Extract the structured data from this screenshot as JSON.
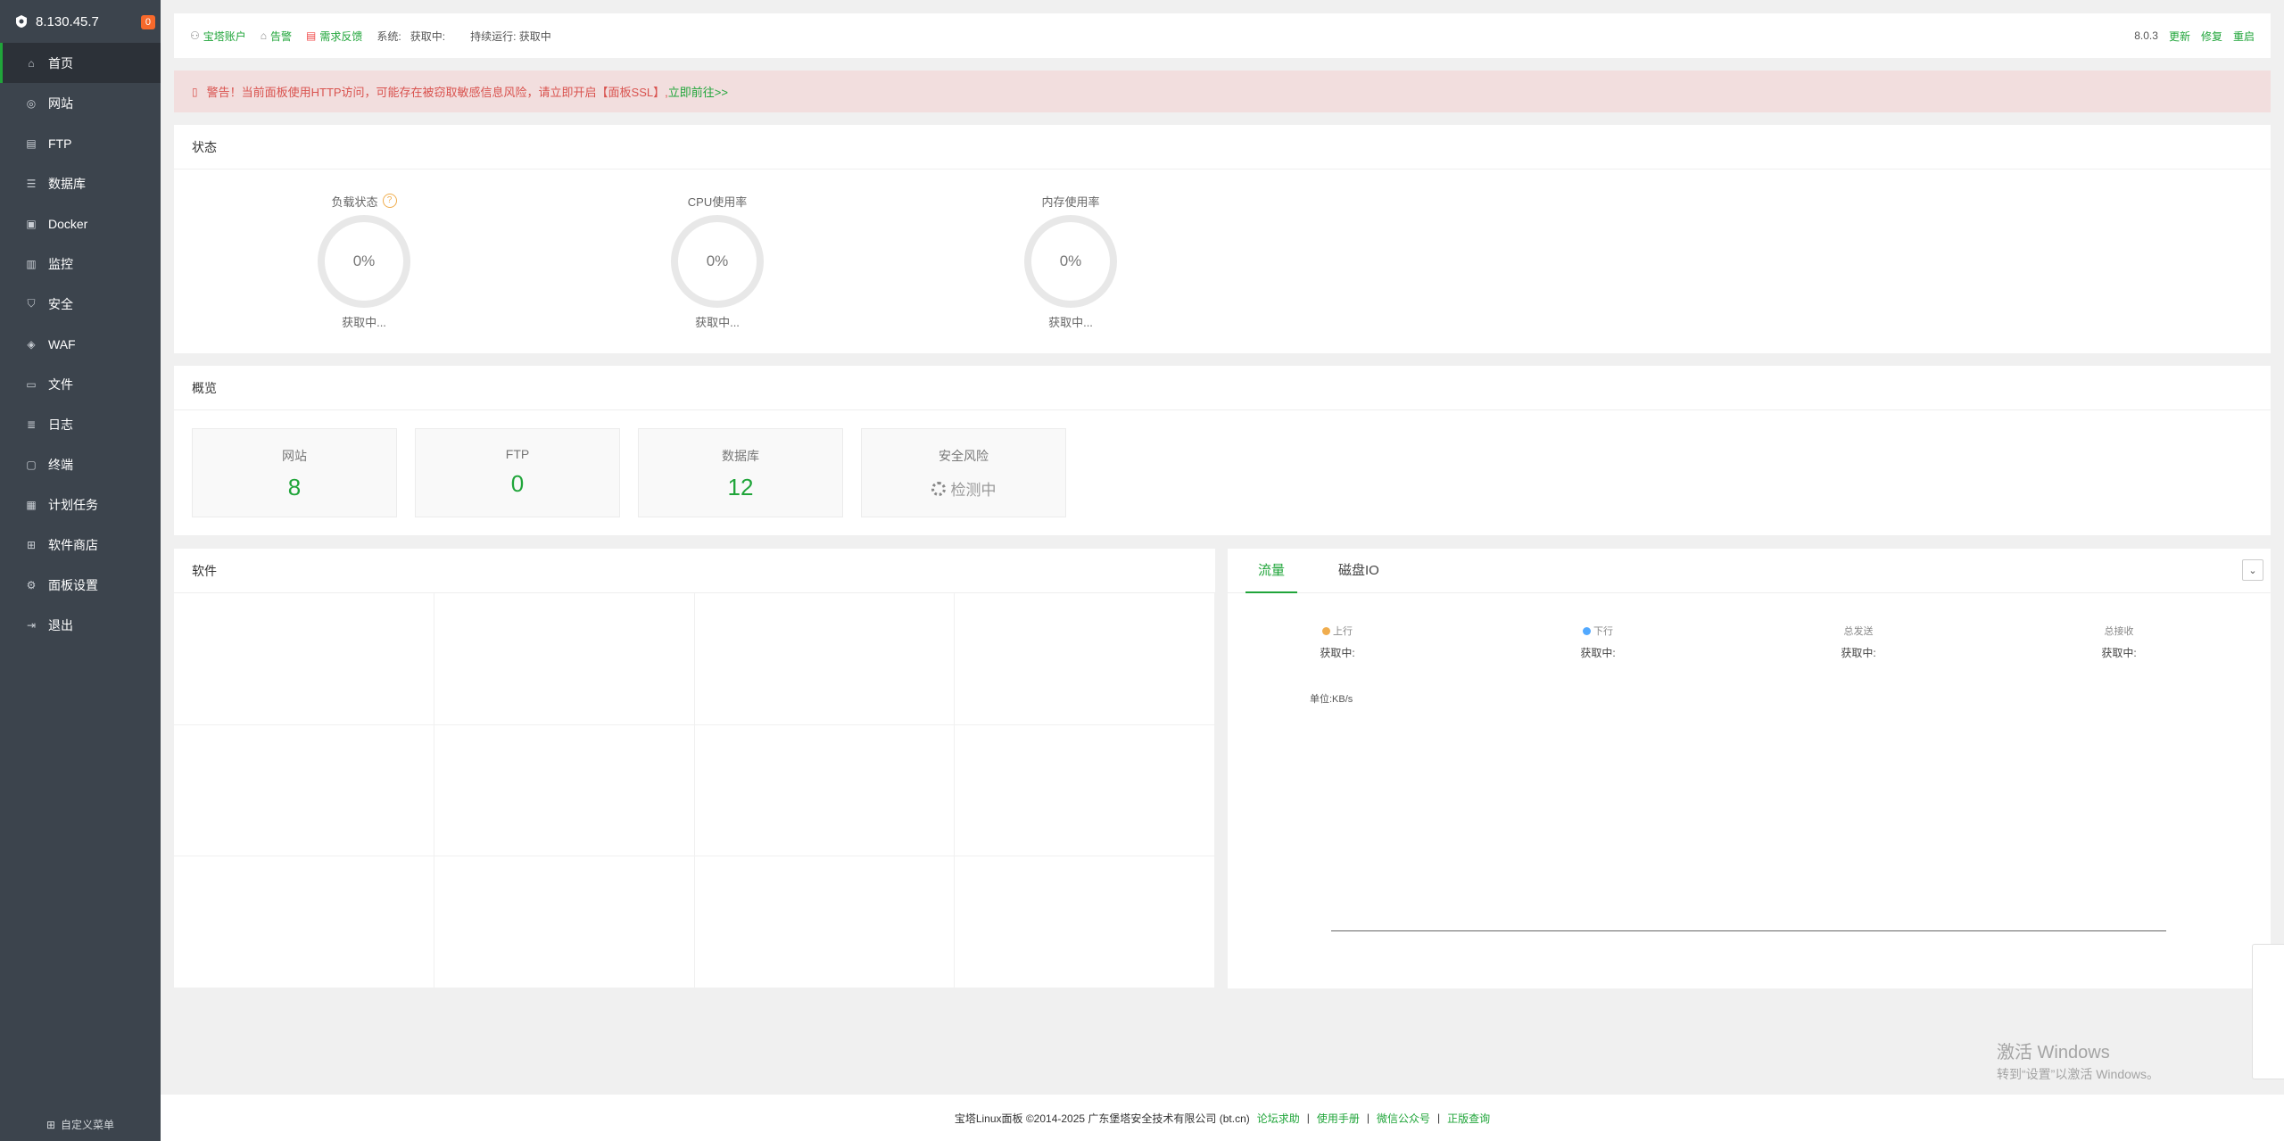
{
  "sidebar": {
    "server_ip": "8.130.45.7",
    "badge": "0",
    "items": [
      {
        "label": "首页",
        "icon": "home-icon"
      },
      {
        "label": "网站",
        "icon": "globe-icon"
      },
      {
        "label": "FTP",
        "icon": "ftp-icon"
      },
      {
        "label": "数据库",
        "icon": "database-icon"
      },
      {
        "label": "Docker",
        "icon": "docker-icon"
      },
      {
        "label": "监控",
        "icon": "monitor-icon"
      },
      {
        "label": "安全",
        "icon": "shield-icon"
      },
      {
        "label": "WAF",
        "icon": "waf-icon"
      },
      {
        "label": "文件",
        "icon": "folder-icon"
      },
      {
        "label": "日志",
        "icon": "log-icon"
      },
      {
        "label": "终端",
        "icon": "terminal-icon"
      },
      {
        "label": "计划任务",
        "icon": "calendar-icon"
      },
      {
        "label": "软件商店",
        "icon": "grid-icon"
      },
      {
        "label": "面板设置",
        "icon": "settings-icon"
      },
      {
        "label": "退出",
        "icon": "logout-icon"
      }
    ],
    "custom_menu": "自定义菜单"
  },
  "topbar": {
    "account": "宝塔账户",
    "alarm": "告警",
    "feedback": "需求反馈",
    "system": "系统:",
    "system_value": "获取中:",
    "uptime": "持续运行: 获取中",
    "version": "8.0.3",
    "update": "更新",
    "repair": "修复",
    "restart": "重启"
  },
  "alert": {
    "icon": "warning-icon",
    "text": "警告！当前面板使用HTTP访问，可能存在被窃取敏感信息风险，请立即开启【面板SSL】, ",
    "link": "立即前往>>"
  },
  "status": {
    "title": "状态",
    "gauges": [
      {
        "label": "负载状态",
        "value": "0%",
        "status": "获取中..."
      },
      {
        "label": "CPU使用率",
        "value": "0%",
        "status": "获取中..."
      },
      {
        "label": "内存使用率",
        "value": "0%",
        "status": "获取中..."
      }
    ],
    "help": "?"
  },
  "overview": {
    "title": "概览",
    "items": [
      {
        "label": "网站",
        "value": "8"
      },
      {
        "label": "FTP",
        "value": "0"
      },
      {
        "label": "数据库",
        "value": "12"
      },
      {
        "label": "安全风险",
        "value": "检测中"
      }
    ]
  },
  "software": {
    "title": "软件"
  },
  "traffic": {
    "tabs": [
      "流量",
      "磁盘IO"
    ],
    "stats": [
      {
        "label": "上行",
        "value": "获取中:",
        "color": "#f0ad4e"
      },
      {
        "label": "下行",
        "value": "获取中:",
        "color": "#52a9ff"
      },
      {
        "label": "总发送",
        "value": "获取中:"
      },
      {
        "label": "总接收",
        "value": "获取中:"
      }
    ],
    "unit": "单位:KB/s"
  },
  "footer": {
    "copyright": "宝塔Linux面板 ©2014-2025 广东堡塔安全技术有限公司 (bt.cn)",
    "links": [
      "论坛求助",
      "使用手册",
      "微信公众号",
      "正版查询"
    ],
    "sep": "|"
  },
  "watermark": {
    "line1": "激活 Windows",
    "line2": "转到“设置”以激活 Windows。"
  }
}
